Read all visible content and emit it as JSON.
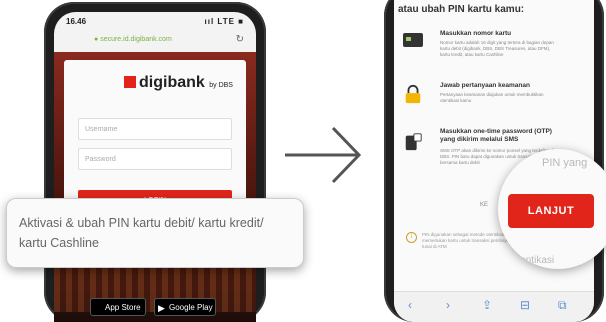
{
  "left_phone": {
    "status_time": "16.46",
    "status_icons": "ııl LTE ■",
    "url": "secure.id.digibank.com",
    "logo_text": "digibank",
    "logo_suffix": "by DBS",
    "username_placeholder": "Username",
    "password_placeholder": "Password",
    "login_button": "LOGIN",
    "app_store_label": "App Store",
    "google_play_label": "Google Play"
  },
  "tooltip": {
    "text": "Aktivasi & ubah PIN kartu debit/ kartu kredit/ kartu Cashline"
  },
  "right_phone": {
    "heading": "atau ubah PIN kartu kamu:",
    "steps": [
      {
        "title": "Masukkan nomor kartu",
        "desc": "Nomor kartu adalah 16 digit yang tertera di bagian depan kartu debit (digibank, DBS, DBS Treasures, atau DFM), kartu kredit, atau kartu Cashline"
      },
      {
        "title": "Jawab pertanyaan keamanan",
        "desc": "Pertanyaan keamanan diajukan untuk membuktikan otentikasi kamu"
      },
      {
        "title": "Masukkan one-time password (OTP) yang dikirim melalui SMS",
        "desc": "SMS OTP akan dikirim ke nomor ponsel yang terdaftar di DBS. PIN baru dapat digunakan untuk transaksi di ATM dan bersama kartu debit"
      }
    ],
    "back_label": "KE",
    "footnote": "PIN digunakan sebagai metode otentikasi transaksi yang memerlukan kartu untuk transaksi pembayaran dan penarikan tunai di ATM",
    "toolbar_icons": [
      "back-icon",
      "forward-icon",
      "share-icon",
      "bookmarks-icon",
      "tabs-icon"
    ]
  },
  "magnifier": {
    "ghost_top": "PIN yang",
    "button": "LANJUT",
    "ghost_bottom": "an otentikasi"
  },
  "colors": {
    "brand_red": "#e1251b",
    "phone_bezel": "#1e1e1e",
    "link_blue": "#5a8fd6"
  }
}
